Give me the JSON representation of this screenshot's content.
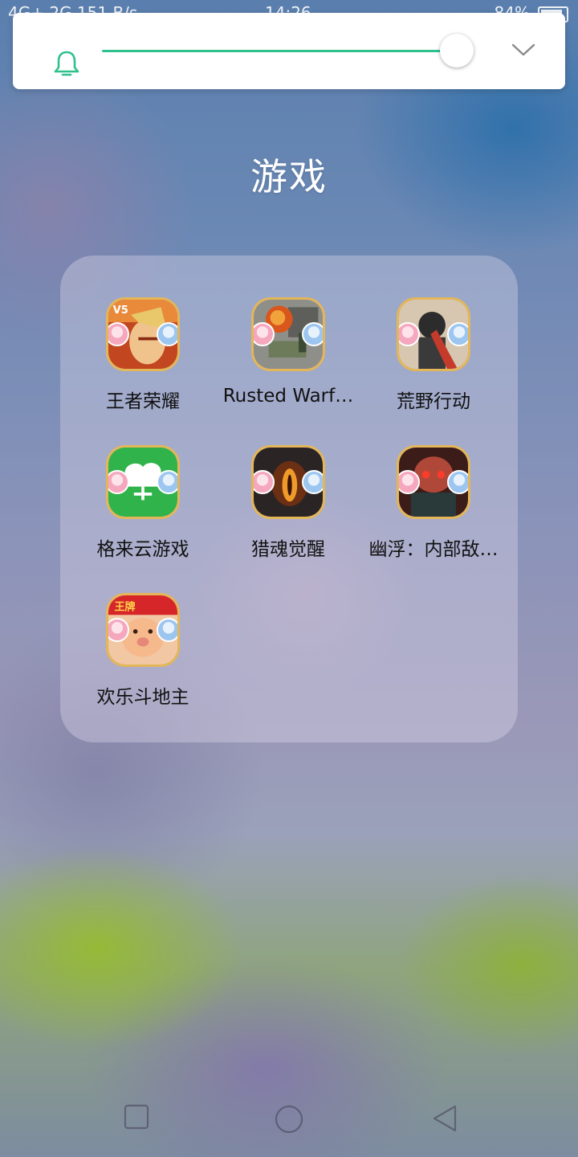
{
  "status_bar": {
    "left": "4G+ 2G 151 B/s",
    "time": "14:26",
    "battery": "84%"
  },
  "volume_panel": {
    "level_fraction": 0.96,
    "ringer_icon": "bell-icon",
    "expand_icon": "chevron-down-icon",
    "accent_color": "#2fc18c"
  },
  "folder": {
    "title": "游戏",
    "apps": [
      {
        "label": "王者荣耀",
        "icon": "honor-of-kings-icon"
      },
      {
        "label": "Rusted Warf…",
        "icon": "rusted-warfare-icon"
      },
      {
        "label": "荒野行动",
        "icon": "knives-out-icon"
      },
      {
        "label": "格来云游戏",
        "icon": "gloud-games-icon"
      },
      {
        "label": "猎魂觉醒",
        "icon": "hunter-awakening-icon"
      },
      {
        "label": "幽浮：内部敌…",
        "icon": "xcom-enemy-within-icon"
      },
      {
        "label": "欢乐斗地主",
        "icon": "happy-landlord-icon"
      }
    ]
  },
  "nav_bar": {
    "buttons": [
      "recent-apps",
      "home",
      "back"
    ]
  }
}
